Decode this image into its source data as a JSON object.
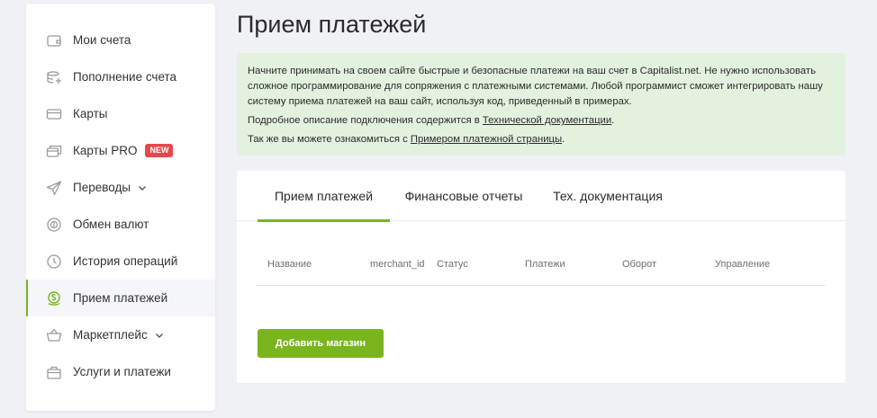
{
  "sidebar": {
    "items": [
      {
        "label": "Мои счета",
        "icon": "wallet-icon"
      },
      {
        "label": "Пополнение счета",
        "icon": "coins-add-icon"
      },
      {
        "label": "Карты",
        "icon": "card-icon"
      },
      {
        "label": "Карты PRO",
        "icon": "cards-pro-icon",
        "badge": "NEW"
      },
      {
        "label": "Переводы",
        "icon": "send-icon"
      },
      {
        "label": "Обмен валют",
        "icon": "exchange-icon"
      },
      {
        "label": "История операций",
        "icon": "clock-icon"
      },
      {
        "label": "Прием платежей",
        "icon": "payment-accept-icon"
      },
      {
        "label": "Маркетплейс",
        "icon": "basket-icon"
      },
      {
        "label": "Услуги и платежи",
        "icon": "services-icon"
      }
    ],
    "active_index": 7
  },
  "page": {
    "title": "Прием платежей"
  },
  "info": {
    "paragraph1": "Начните принимать на своем сайте быстрые и безопасные платежи на ваш счет в Capitalist.net. Не нужно использовать сложное программирование для сопряжения с платежными системами. Любой программист сможет интегрировать нашу систему приема платежей на ваш сайт, используя код, приведенный в примерах.",
    "paragraph2_prefix": "Подробное описание подключения содержится в ",
    "paragraph2_link": "Технической документации",
    "paragraph2_suffix": ".",
    "paragraph3_prefix": "Так же вы можете ознакомиться с ",
    "paragraph3_link": "Примером платежной страницы",
    "paragraph3_suffix": "."
  },
  "tabs": [
    {
      "label": "Прием платежей",
      "active": true
    },
    {
      "label": "Финансовые отчеты",
      "active": false
    },
    {
      "label": "Тех. документация",
      "active": false
    }
  ],
  "table": {
    "columns": [
      "Название",
      "merchant_id",
      "Статус",
      "Платежи",
      "Оборот",
      "Управление"
    ],
    "rows": []
  },
  "actions": {
    "add_store": "Добавить магазин"
  },
  "colors": {
    "accent": "#7ab51d",
    "info_bg": "#e3f1df",
    "badge": "#e5484d"
  }
}
